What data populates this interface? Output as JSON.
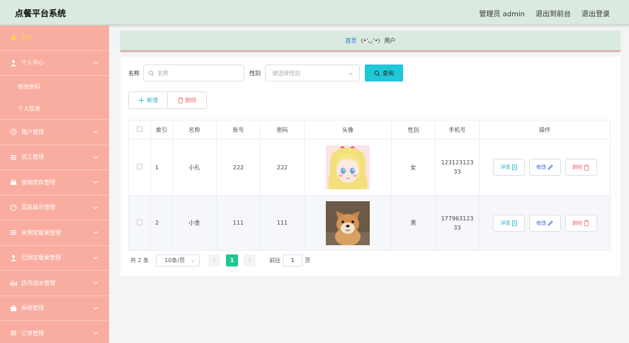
{
  "app": {
    "title": "点餐平台系统",
    "top_links": [
      "管理员 admin",
      "退出到前台",
      "退出登录"
    ]
  },
  "sidebar": {
    "items": [
      {
        "label": "首页",
        "icon": "home-icon",
        "active": true
      },
      {
        "label": "个人中心",
        "icon": "user-icon",
        "expanded": true,
        "children": [
          "修改密码",
          "个人信息"
        ]
      },
      {
        "label": "用户管理",
        "icon": "clock-icon"
      },
      {
        "label": "员工管理",
        "icon": "list-icon"
      },
      {
        "label": "食物库存管理",
        "icon": "box-icon"
      },
      {
        "label": "菜品展示管理",
        "icon": "dashboard-icon"
      },
      {
        "label": "未预定餐桌管理",
        "icon": "list-icon"
      },
      {
        "label": "已预定餐桌管理",
        "icon": "user-icon"
      },
      {
        "label": "店内流水管理",
        "icon": "bar-chart-icon"
      },
      {
        "label": "系统管理",
        "icon": "briefcase-icon"
      },
      {
        "label": "订单管理",
        "icon": "sliders-icon"
      }
    ]
  },
  "breadcrumb": {
    "home": "首页",
    "separator": "(•'◡'•)",
    "current": "用户"
  },
  "search": {
    "name_label": "名称",
    "name_placeholder": "名称",
    "gender_label": "性别",
    "gender_placeholder": "请选择性别",
    "query_label": "查询"
  },
  "actions": {
    "add_label": "新增",
    "delete_label": "删除"
  },
  "table": {
    "headers": [
      "",
      "索引",
      "名称",
      "账号",
      "密码",
      "头像",
      "性别",
      "手机号",
      "操作"
    ],
    "rows": [
      {
        "index": "1",
        "name": "小礼",
        "account": "222",
        "password": "222",
        "avatar": "anime-girl-avatar",
        "gender": "女",
        "phone_line1": "123123123",
        "phone_line2": "33"
      },
      {
        "index": "2",
        "name": "小金",
        "account": "111",
        "password": "111",
        "avatar": "shiba-dog-avatar",
        "gender": "男",
        "phone_line1": "177963123",
        "phone_line2": "33"
      }
    ],
    "row_actions": {
      "detail": "详情",
      "edit": "修改",
      "delete": "删除"
    }
  },
  "pagination": {
    "total": "共 2 条",
    "page_size": "10条/页",
    "current_page": "1",
    "goto_label": "前往",
    "goto_value": "1",
    "page_suffix": "页"
  },
  "colors": {
    "sidebar": "#f9ada0",
    "topbar": "#dbeadf",
    "accent": "#1ec8d8",
    "active_page": "#1ec88e",
    "danger": "#f56c6c"
  }
}
